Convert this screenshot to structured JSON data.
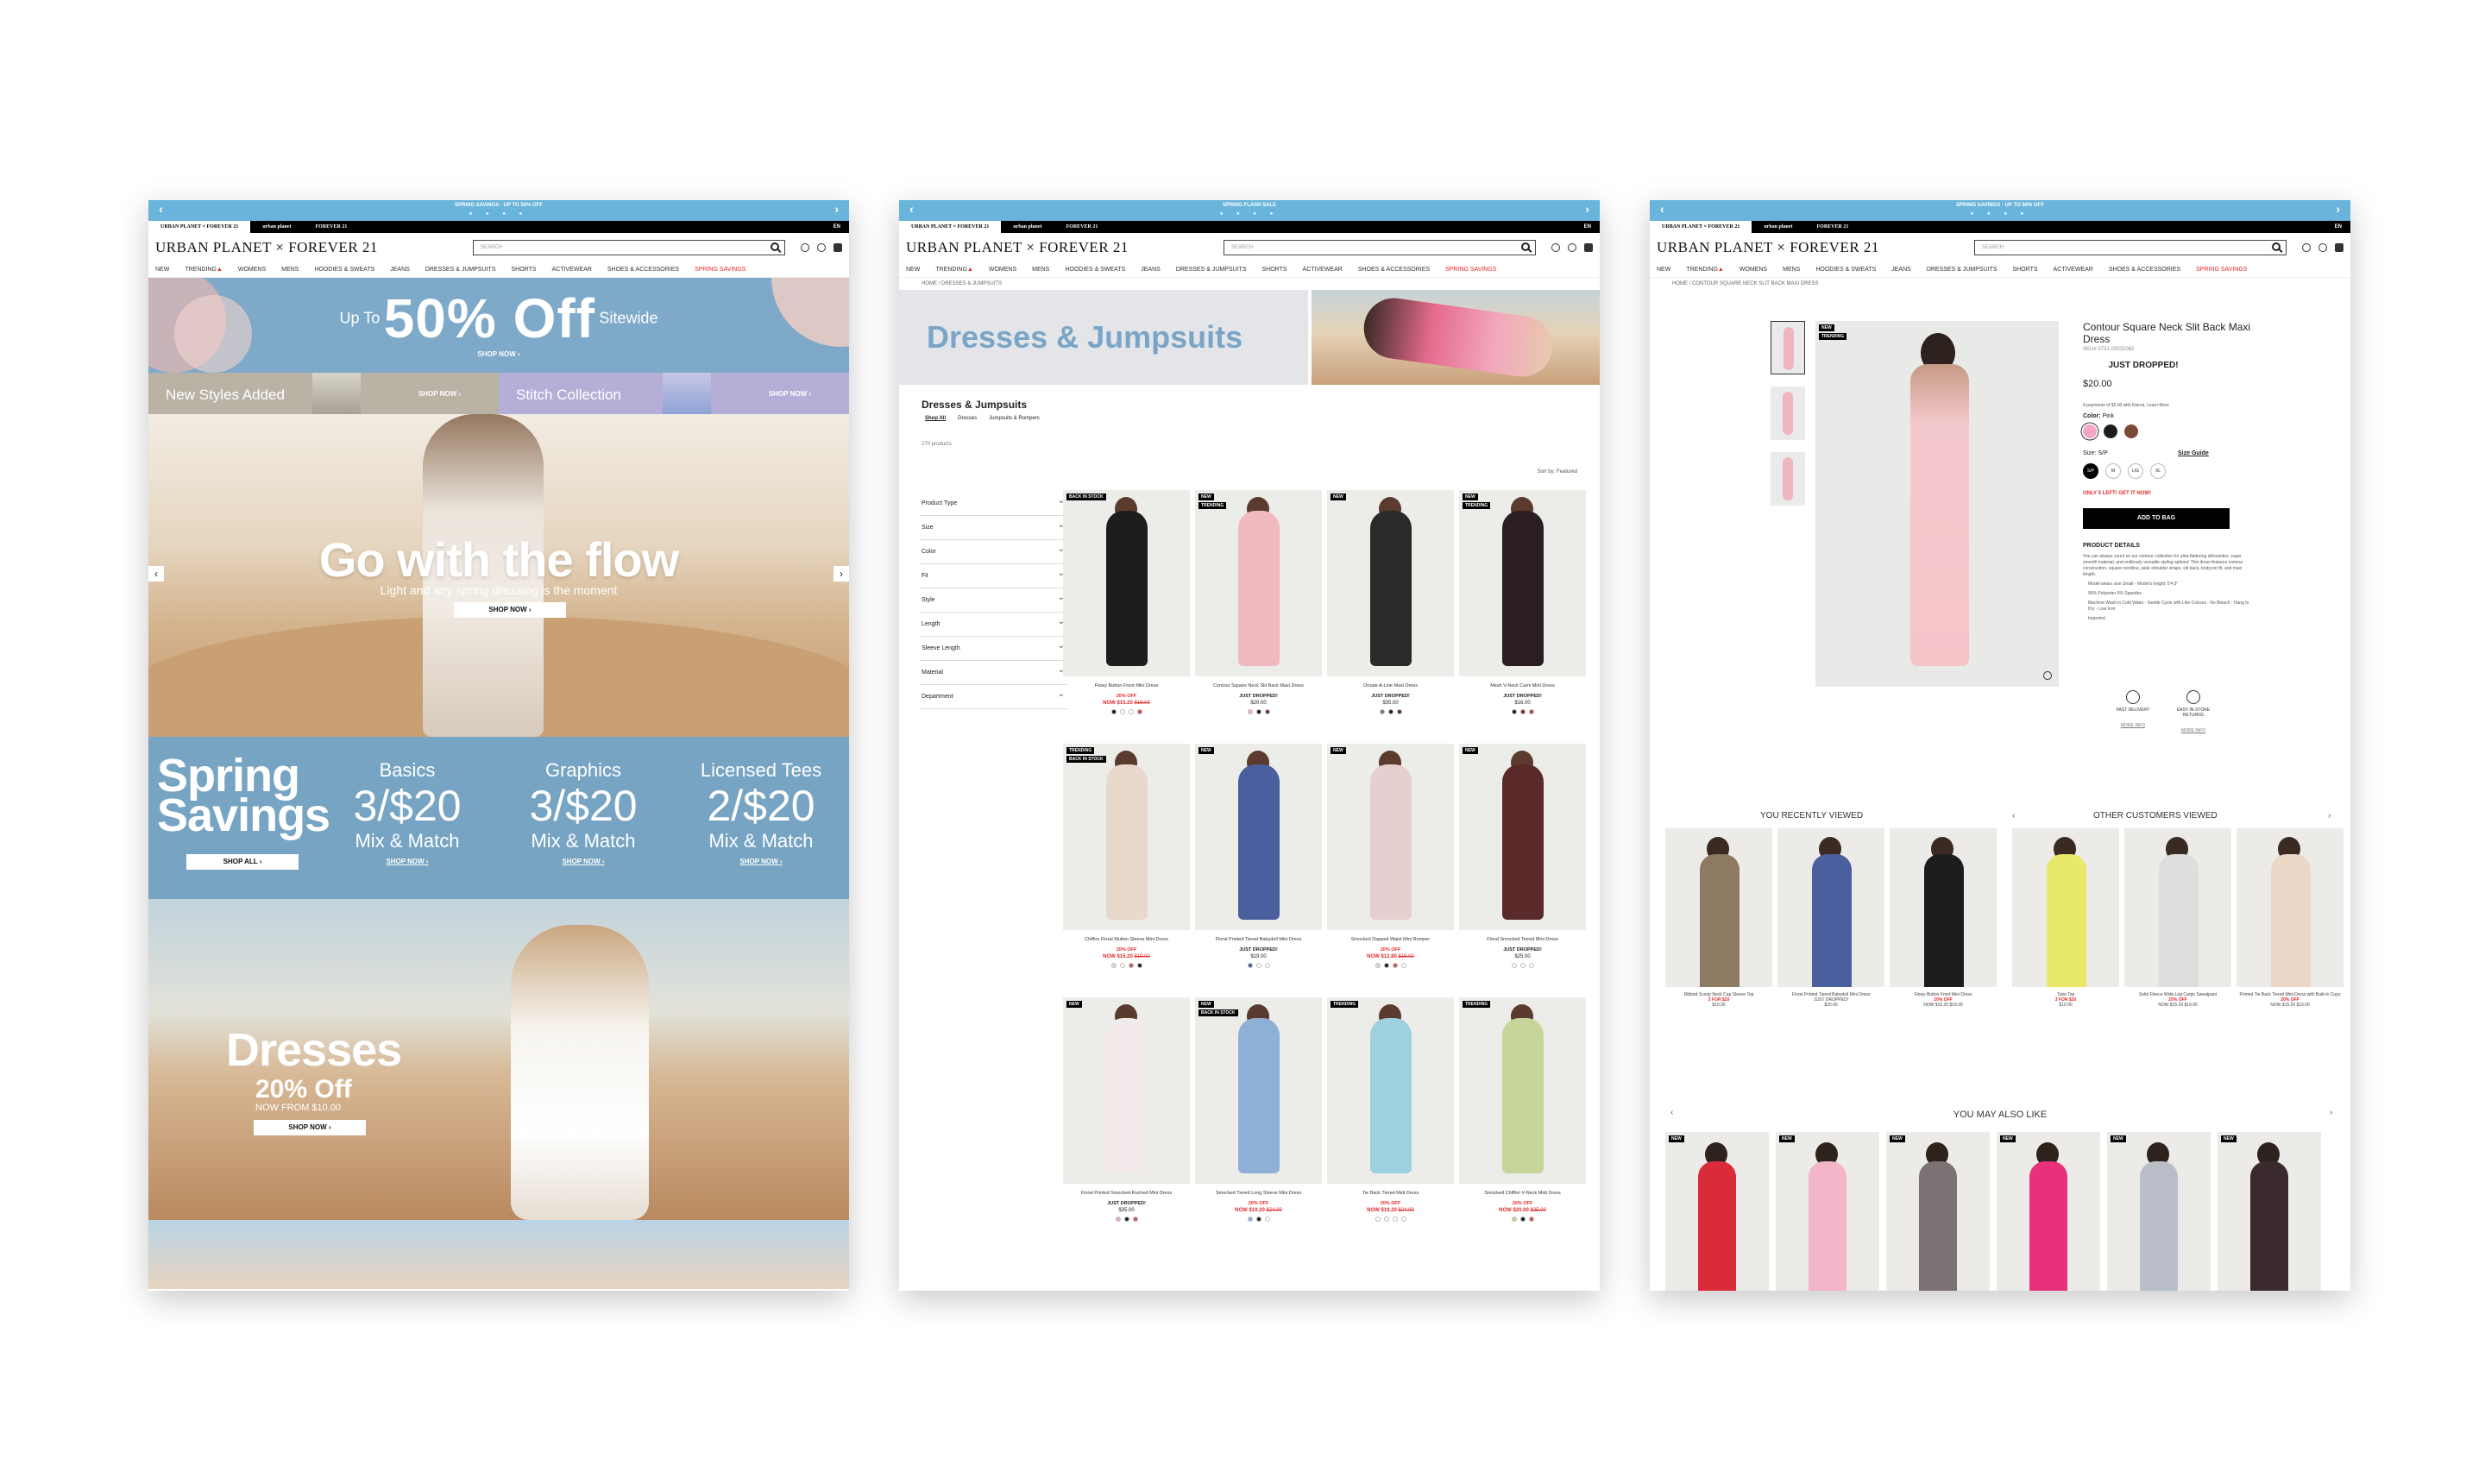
{
  "common": {
    "promo_text": "SPRING SAVINGS   ·   UP TO 50% OFF",
    "promo_text_2": "SPRING SAVINGS   ·   UP TO 50% OFF",
    "tab_urban": "URBAN PLANET × FOREVER 21",
    "tab_urban2": "urban planet",
    "tab_f21": "FOREVER 21",
    "lang": "EN",
    "logo": "URBAN PLANET × FOREVER 21",
    "search_placeholder": "SEARCH",
    "nav": [
      "NEW",
      "TRENDING",
      "WOMENS",
      "MENS",
      "HOODIES & SWEATS",
      "JEANS",
      "DRESSES & JUMPSUITS",
      "SHORTS",
      "ACTIVEWEAR",
      "SHOES & ACCESSORIES",
      "SPRING SAVINGS"
    ],
    "colors": {
      "promo_bar": "#69b4da",
      "sale_red": "#e52a2a",
      "banner_blue": "#7ea9c9"
    }
  },
  "home": {
    "banner_up_to": "Up To",
    "banner_big": "50% Off",
    "banner_sitewide": "Sitewide",
    "banner_shop": "SHOP NOW ›",
    "new_styles": "New Styles Added",
    "new_styles_shop": "SHOP NOW ›",
    "stitch": "Stitch Collection",
    "stitch_shop": "SHOP NOW ›",
    "hero_title": "Go with the flow",
    "hero_sub": "Light and airy spring dressing is the moment",
    "hero_btn": "SHOP NOW ›",
    "spring_title_1": "Spring",
    "spring_title_2": "Savings",
    "spring_btn": "SHOP ALL ›",
    "deals": [
      {
        "name": "Basics",
        "price": "3/$20",
        "mix": "Mix & Match",
        "shop": "SHOP NOW ›"
      },
      {
        "name": "Graphics",
        "price": "3/$20",
        "mix": "Mix & Match",
        "shop": "SHOP NOW ›"
      },
      {
        "name": "Licensed Tees",
        "price": "2/$20",
        "mix": "Mix & Match",
        "shop": "SHOP NOW ›"
      }
    ],
    "dresses_title": "Dresses",
    "dresses_off": "20% Off",
    "dresses_from": "NOW FROM $10.00",
    "dresses_btn": "SHOP NOW ›"
  },
  "category": {
    "promo_text": "SPRING FLASH SALE",
    "breadcrumb": "HOME / DRESSES & JUMPSUITS",
    "banner_title": "Dresses & Jumpsuits",
    "page_title": "Dresses & Jumpsuits",
    "subtabs": [
      "Shop All",
      "Dresses",
      "Jumpsuits & Rompers"
    ],
    "count": "270 products",
    "sort": "Sort by: Featured",
    "filters": [
      "Product Type",
      "Size",
      "Color",
      "Fit",
      "Style",
      "Length",
      "Sleeve Length",
      "Material",
      "Department"
    ],
    "products": [
      {
        "badge": "BACK IN STOCK",
        "name": "Flowy Button Front Mini Dress",
        "tag": "20% OFF",
        "now": "NOW $15.20",
        "old": "$19.00",
        "dress": "#1d1d1d",
        "swatches": [
          "#1d1d1d",
          "#ffffff",
          "#ffffff",
          "#d94040"
        ]
      },
      {
        "badge": "NEW",
        "badge2": "TRENDING",
        "name": "Contour Square Neck Slit Back Maxi Dress",
        "tag": "JUST DROPPED!",
        "now": "$20.00",
        "old": "",
        "dress": "#f1b9c0",
        "swatches": [
          "#f0b6c0",
          "#1d1d1d",
          "#6b3a2a"
        ]
      },
      {
        "badge": "NEW",
        "name": "Ornate A-Line Maxi Dress",
        "tag": "JUST DROPPED!",
        "now": "$35.00",
        "old": "",
        "dress": "#2a2a2a",
        "swatches": [
          "#777777",
          "#1d1d1d",
          "#5a2a2a"
        ]
      },
      {
        "badge": "NEW",
        "badge2": "TRENDING",
        "name": "Mesh V-Neck Cami Mini Dress",
        "tag": "JUST DROPPED!",
        "now": "$16.00",
        "old": "",
        "dress": "#2b1e22",
        "swatches": [
          "#1d1d1d",
          "#7a2a3a",
          "#c23b3b"
        ]
      },
      {
        "badge": "TRENDING",
        "badge2": "BACK IN STOCK",
        "name": "Chiffon Floral Mutton Sleeve Mini Dress",
        "tag": "20% OFF",
        "now": "NOW $15.20",
        "old": "$19.00",
        "dress": "#e8d9cc",
        "swatches": [
          "#e8d9cc",
          "#ffffff",
          "#c75a5a",
          "#1d1d1d"
        ]
      },
      {
        "badge": "NEW",
        "name": "Floral Printed Tiered Babydoll Mini Dress",
        "tag": "JUST DROPPED!",
        "now": "$19.00",
        "old": "",
        "dress": "#4a5f9e",
        "swatches": [
          "#4a5f9e",
          "#ffffff",
          "#ffffff"
        ]
      },
      {
        "badge": "NEW",
        "name": "Smocked Dapped Waist Mini Romper",
        "tag": "20% OFF",
        "now": "NOW $12.80",
        "old": "$16.00",
        "dress": "#e5cfcf",
        "swatches": [
          "#e5cfcf",
          "#1d1d1d",
          "#c75a5a",
          "#ffffff"
        ]
      },
      {
        "badge": "NEW",
        "name": "Floral Smocked Tiered Mini Dress",
        "tag": "JUST DROPPED!",
        "now": "$25.00",
        "old": "",
        "dress": "#5a2a2a",
        "swatches": [
          "#ffffff",
          "#ffffff",
          "#ffffff"
        ]
      },
      {
        "badge": "NEW",
        "name": "Floral Printed Smocked Ruched Mini Dress",
        "tag": "JUST DROPPED!",
        "now": "$35.00",
        "old": "",
        "dress": "#f2eaea",
        "swatches": [
          "#e0b0b0",
          "#1d1d1d",
          "#c75a5a"
        ]
      },
      {
        "badge": "NEW",
        "badge2": "BACK IN STOCK",
        "name": "Smocked Tiered Long Sleeve Mini Dress",
        "tag": "20% OFF",
        "now": "NOW $19.20",
        "old": "$24.00",
        "dress": "#8fb0d6",
        "swatches": [
          "#8fb0d6",
          "#1d1d1d",
          "#ffffff"
        ]
      },
      {
        "badge": "TRENDING",
        "name": "Tie Back Tiered Midi Dress",
        "tag": "20% OFF",
        "now": "NOW $19.20",
        "old": "$24.00",
        "dress": "#9fd0e0",
        "swatches": [
          "#ffffff",
          "#ffffff",
          "#ffffff",
          "#ffffff"
        ]
      },
      {
        "badge": "TRENDING",
        "name": "Smocked Chiffon V-Neck Midi Dress",
        "tag": "20% OFF",
        "now": "NOW $20.00",
        "old": "$25.00",
        "dress": "#c6d69a",
        "swatches": [
          "#c6d69a",
          "#1d1d1d",
          "#c75a5a"
        ]
      }
    ]
  },
  "product": {
    "breadcrumb": "HOME / CONTOUR SQUARE NECK SLIT BACK MAXI DRESS",
    "badge": "NEW",
    "badge2": "TRENDING",
    "name": "Contour Square Neck Slit Back Maxi Dress",
    "sku": "SKU# 0731-03031082",
    "just_dropped": "JUST DROPPED!",
    "price": "$20.00",
    "klarna": "4 payments of $5.00 with Klarna. Learn More",
    "color_label": "Color:",
    "color_value": "Pink",
    "colors": [
      "#f4a6c7",
      "#1d1d1d",
      "#7a4a36"
    ],
    "size_label": "Size: S/P",
    "size_guide": "Size Guide",
    "sizes": [
      "S/P",
      "M",
      "L/G",
      "XL"
    ],
    "left": "ONLY 5 LEFT! GET IT NOW!",
    "add_to_bag": "ADD TO BAG",
    "details_title": "PRODUCT DETAILS",
    "details_text": "You can always count on our contour collection for ultra-flattering silhouettes, super smooth material, and endlessly versatile styling options! This dress features contour construction, square neckline, wide shoulder straps, slit back, bodycon fit, and maxi length.",
    "details_list": [
      "Model wears size Small - Model's height: 5'4.5\"",
      "95% Polyester 5% Spandex",
      "Machine Wash in Cold Water - Gentle Cycle with Like Colours - No Bleach - Hang to Dry - Low Iron",
      "Imported"
    ],
    "svc": [
      {
        "label": "FAST DELIVERY",
        "more": "MORE INFO"
      },
      {
        "label": "EASY IN-STORE RETURNS",
        "more": "MORE INFO"
      }
    ],
    "recent_title": "YOU RECENTLY VIEWED",
    "others_title": "OTHER CUSTOMERS VIEWED",
    "recent": [
      {
        "name": "Ribbed Scoop Neck Cap Sleeve Top",
        "tag": "3 FOR $20",
        "price": "$10.00",
        "dress": "#8c7a62"
      },
      {
        "name": "Floral Printed Tiered Babydoll Mini Dress",
        "tag": "JUST DROPPED!",
        "price": "$20.00",
        "dress": "#4a5f9e"
      },
      {
        "name": "Flowy Button Front Mini Dress",
        "tag": "20% OFF",
        "price": "NOW $15.20 $19.00",
        "dress": "#1d1d1d"
      }
    ],
    "others": [
      {
        "name": "Tube Top",
        "tag": "3 FOR $20",
        "price": "$10.00",
        "dress": "#e8e86a"
      },
      {
        "name": "Solid Fleece Wide Leg Cargo Sweatpant",
        "tag": "20% OFF",
        "price": "NOW $15.20 $19.00",
        "dress": "#dedede"
      },
      {
        "name": "Printed Tie Back Tiered Mini Dress with Built-In Cups",
        "tag": "20% OFF",
        "price": "NOW $15.20 $19.00",
        "dress": "#ead7c6"
      }
    ],
    "also_title": "YOU MAY ALSO LIKE",
    "also": [
      {
        "badge": "NEW",
        "dress": "#d92b3a"
      },
      {
        "badge": "NEW",
        "dress": "#f3b5c8"
      },
      {
        "badge": "NEW",
        "dress": "#7b7373"
      },
      {
        "badge": "NEW",
        "dress": "#e8317a"
      },
      {
        "badge": "NEW",
        "dress": "#b9bec9"
      },
      {
        "badge": "NEW",
        "dress": "#3a2a2e"
      }
    ]
  }
}
